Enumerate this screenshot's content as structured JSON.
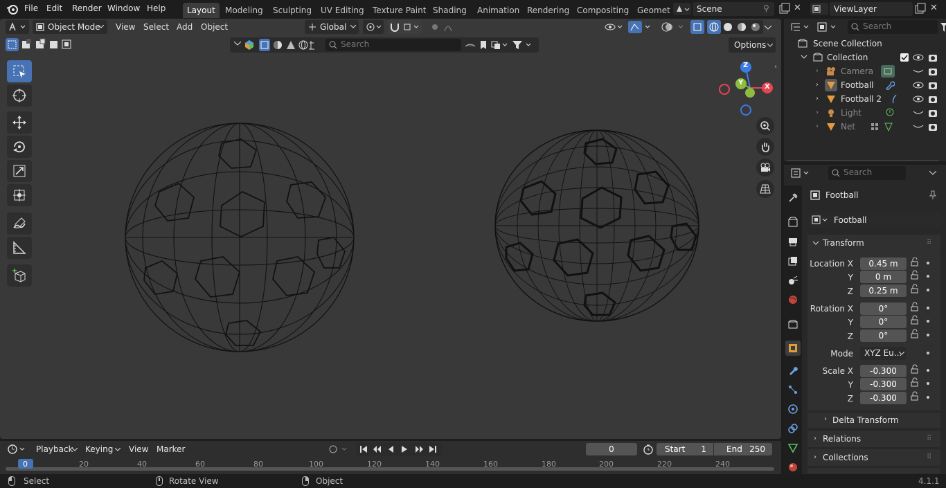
{
  "menus": [
    "File",
    "Edit",
    "Render",
    "Window",
    "Help"
  ],
  "workspaces": [
    "Layout",
    "Modeling",
    "Sculpting",
    "UV Editing",
    "Texture Paint",
    "Shading",
    "Animation",
    "Rendering",
    "Compositing",
    "Geomet"
  ],
  "scene": "Scene",
  "view_layer": "ViewLayer",
  "viewport": {
    "mode": "Object Mode",
    "menus": [
      "View",
      "Select",
      "Add",
      "Object"
    ],
    "orientation": "Global",
    "options_label": "Options",
    "search_placeholder": "Search"
  },
  "gizmo": {
    "z": "Z",
    "y": "Y",
    "x": "X"
  },
  "outliner": {
    "search_placeholder": "Search",
    "scene_collection": "Scene Collection",
    "collection": "Collection",
    "items": [
      "Camera",
      "Football",
      "Football 2",
      "Light",
      "Net"
    ]
  },
  "properties": {
    "search_placeholder": "Search",
    "object_name": "Football",
    "data_name": "Football",
    "transform_label": "Transform",
    "location_label": "Location X",
    "rotation_label": "Rotation X",
    "scale_label": "Scale X",
    "y_label": "Y",
    "z_label": "Z",
    "mode_label": "Mode",
    "location": [
      "0.45 m",
      "0 m",
      "0.25 m"
    ],
    "rotation": [
      "0°",
      "0°",
      "0°"
    ],
    "mode_value": "XYZ Eu...",
    "scale": [
      "-0.300",
      "-0.300",
      "-0.300"
    ],
    "delta_transform": "Delta Transform",
    "relations": "Relations",
    "collections": "Collections"
  },
  "timeline": {
    "menus": [
      "Playback",
      "Keying",
      "View",
      "Marker"
    ],
    "current_frame": "0",
    "start_label": "Start",
    "start": "1",
    "end_label": "End",
    "end": "250",
    "ticks": [
      "0",
      "20",
      "40",
      "60",
      "80",
      "100",
      "120",
      "140",
      "160",
      "180",
      "200",
      "220",
      "240"
    ]
  },
  "status": {
    "select": "Select",
    "rotate_view": "Rotate View",
    "object": "Object",
    "version": "4.1.1"
  },
  "colors": {
    "accent": "#4772b3",
    "x_axis": "#e64553",
    "y_axis": "#8cbd3e",
    "z_axis": "#3b7ae3"
  }
}
